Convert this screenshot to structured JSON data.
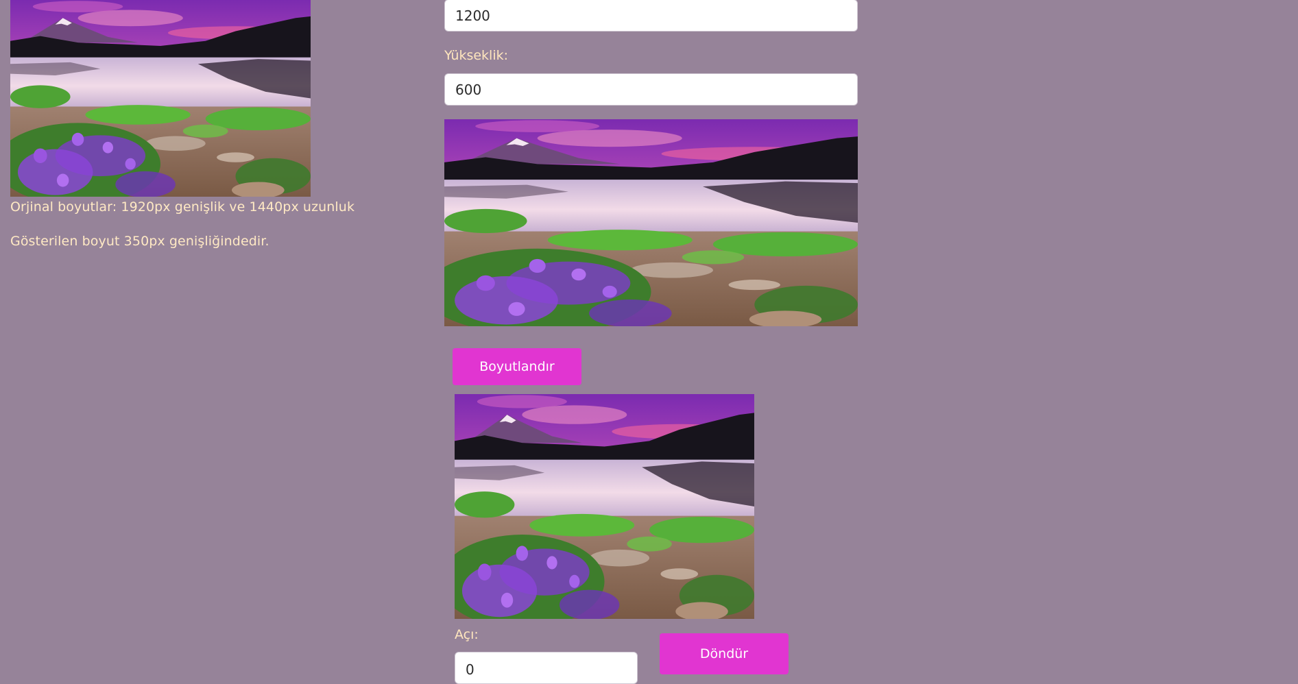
{
  "colors": {
    "background": "#968399",
    "text": "#ffe9c4",
    "button": "#e135d1",
    "button_text": "#ffffff"
  },
  "original_panel": {
    "image_alt": "mountain-lake-landscape",
    "dimensions_text": "Orjinal boyutlar: 1920px genişlik ve 1440px uzunluk",
    "display_text": "Gösterilen boyut 350px genişliğindedir."
  },
  "resize_form": {
    "width_value": "1200",
    "height_label": "Yükseklik:",
    "height_value": "600",
    "resized_image_alt": "resized-mountain-lake-landscape",
    "resize_button": "Boyutlandır"
  },
  "rotate_form": {
    "rotated_image_alt": "rotated-mountain-lake-landscape",
    "angle_label": "Açı:",
    "angle_value": "0",
    "rotate_button": "Döndür"
  }
}
